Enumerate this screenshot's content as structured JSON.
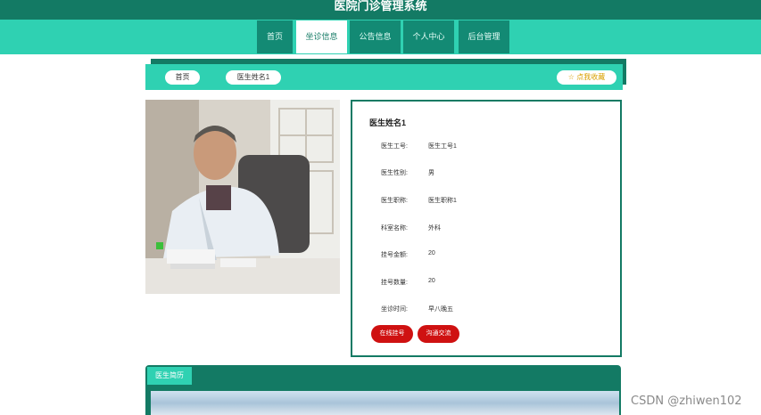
{
  "header": {
    "title": "医院门诊管理系统"
  },
  "nav": {
    "items": [
      {
        "label": "首页"
      },
      {
        "label": "坐诊信息",
        "active": true
      },
      {
        "label": "公告信息"
      },
      {
        "label": "个人中心"
      },
      {
        "label": "后台管理"
      }
    ]
  },
  "breadcrumb": {
    "home": "首页",
    "current": "医生姓名1",
    "favorite": "☆ 点我收藏"
  },
  "doctor": {
    "name": "医生姓名1",
    "fields": [
      {
        "label": "医生工号:",
        "value": "医生工号1"
      },
      {
        "label": "医生性别:",
        "value": "男"
      },
      {
        "label": "医生职称:",
        "value": "医生职称1"
      },
      {
        "label": "科室名称:",
        "value": "外科"
      },
      {
        "label": "挂号金额:",
        "value": "20"
      },
      {
        "label": "挂号数量:",
        "value": "20"
      },
      {
        "label": "坐诊时间:",
        "value": "早八晚五"
      }
    ],
    "buttons": {
      "register": "在线挂号",
      "chat": "沟通交流"
    }
  },
  "intro": {
    "tab": "医生简历"
  },
  "watermark": "CSDN @zhiwen102",
  "colors": {
    "primary": "#137a64",
    "accent": "#2fd1b2",
    "button": "#cf1111"
  }
}
